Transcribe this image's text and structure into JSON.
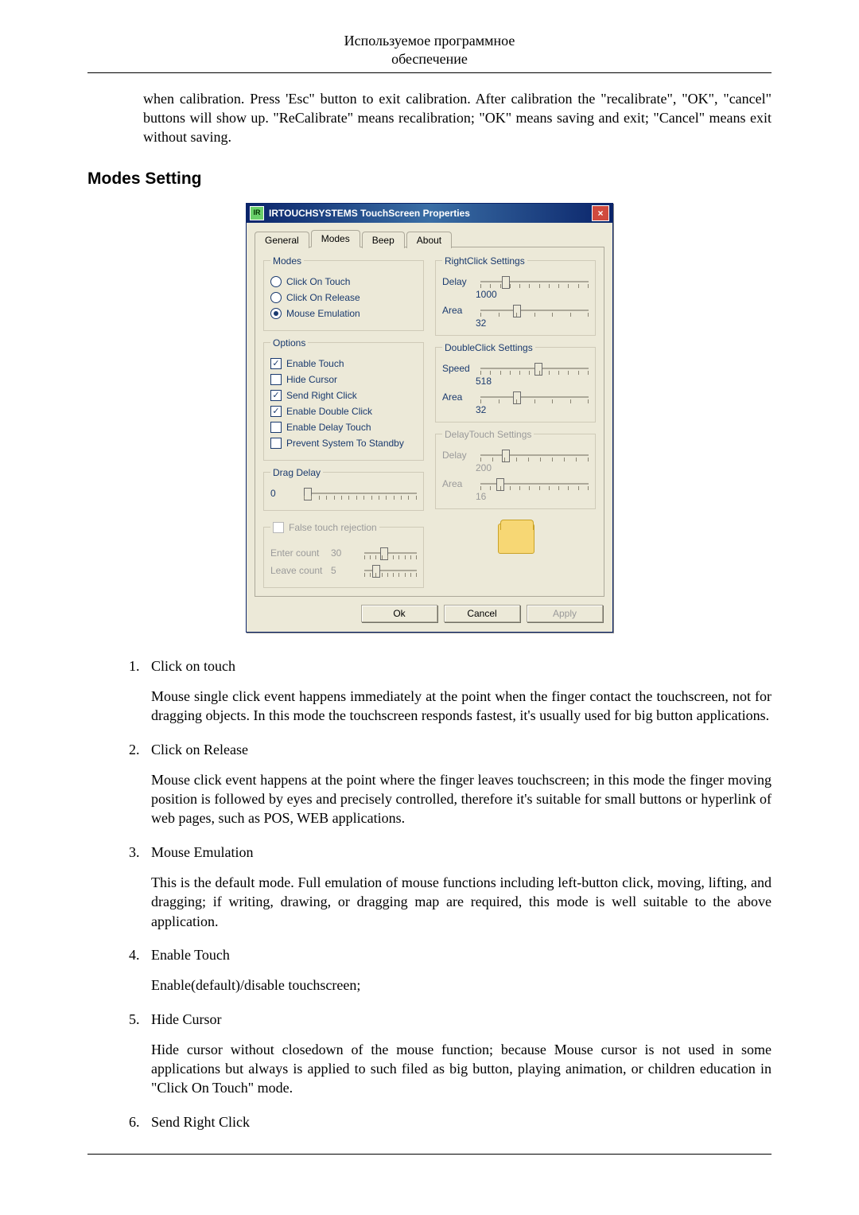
{
  "header": {
    "line1": "Используемое программное",
    "line2": "обеспечение"
  },
  "intro": "when calibration. Press 'Esc\" button to exit calibration. After calibration the \"recalibrate\", \"OK\", \"cancel\" buttons will show up. \"ReCalibrate\" means recalibration; \"OK\" means saving and exit; \"Cancel\" means exit without saving.",
  "section_heading": "Modes Setting",
  "dialog": {
    "title": "IRTOUCHSYSTEMS TouchScreen Properties",
    "close": "×",
    "tabs": {
      "general": "General",
      "modes": "Modes",
      "beep": "Beep",
      "about": "About"
    },
    "modes_group": {
      "legend": "Modes",
      "click_on_touch": "Click On Touch",
      "click_on_release": "Click On Release",
      "mouse_emulation": "Mouse Emulation"
    },
    "options_group": {
      "legend": "Options",
      "enable_touch": "Enable Touch",
      "hide_cursor": "Hide Cursor",
      "send_right_click": "Send Right Click",
      "enable_double_click": "Enable Double Click",
      "enable_delay_touch": "Enable Delay Touch",
      "prevent_standby": "Prevent System To Standby"
    },
    "drag_delay": {
      "legend": "Drag Delay",
      "value": "0"
    },
    "false_touch": {
      "legend_checkbox": "False touch rejection",
      "enter_label": "Enter count",
      "enter_value": "30",
      "leave_label": "Leave count",
      "leave_value": "5"
    },
    "rightclick": {
      "legend": "RightClick Settings",
      "delay_label": "Delay",
      "delay_value": "1000",
      "area_label": "Area",
      "area_value": "32"
    },
    "doubleclick": {
      "legend": "DoubleClick Settings",
      "speed_label": "Speed",
      "speed_value": "518",
      "area_label": "Area",
      "area_value": "32"
    },
    "delaytouch": {
      "legend": "DelayTouch Settings",
      "delay_label": "Delay",
      "delay_value": "200",
      "area_label": "Area",
      "area_value": "16"
    },
    "buttons": {
      "ok": "Ok",
      "cancel": "Cancel",
      "apply": "Apply"
    }
  },
  "list": {
    "i1": {
      "title": "Click on touch",
      "body": "Mouse single click event happens immediately at the point when the finger contact the touchscreen, not for dragging objects. In this mode the touchscreen responds fastest, it's usually used for big button applications."
    },
    "i2": {
      "title": "Click on Release",
      "body": "Mouse click event happens at the point where the finger leaves touchscreen; in this mode the finger moving position is followed by eyes and precisely controlled, therefore it's suitable for small buttons or hyperlink of web pages, such as POS, WEB applications."
    },
    "i3": {
      "title": "Mouse Emulation",
      "body": "This is the default mode. Full emulation of mouse functions including left-button click, moving, lifting, and dragging; if writing, drawing, or dragging map are required, this mode is well suitable to the above application."
    },
    "i4": {
      "title": "Enable Touch",
      "body": "Enable(default)/disable touchscreen;"
    },
    "i5": {
      "title": "Hide Cursor",
      "body": "Hide cursor without closedown of the mouse function; because Mouse cursor is not used in some applications but always is applied to such filed as big button, playing animation, or children education in \"Click On Touch\" mode."
    },
    "i6": {
      "title": "Send Right Click"
    }
  }
}
